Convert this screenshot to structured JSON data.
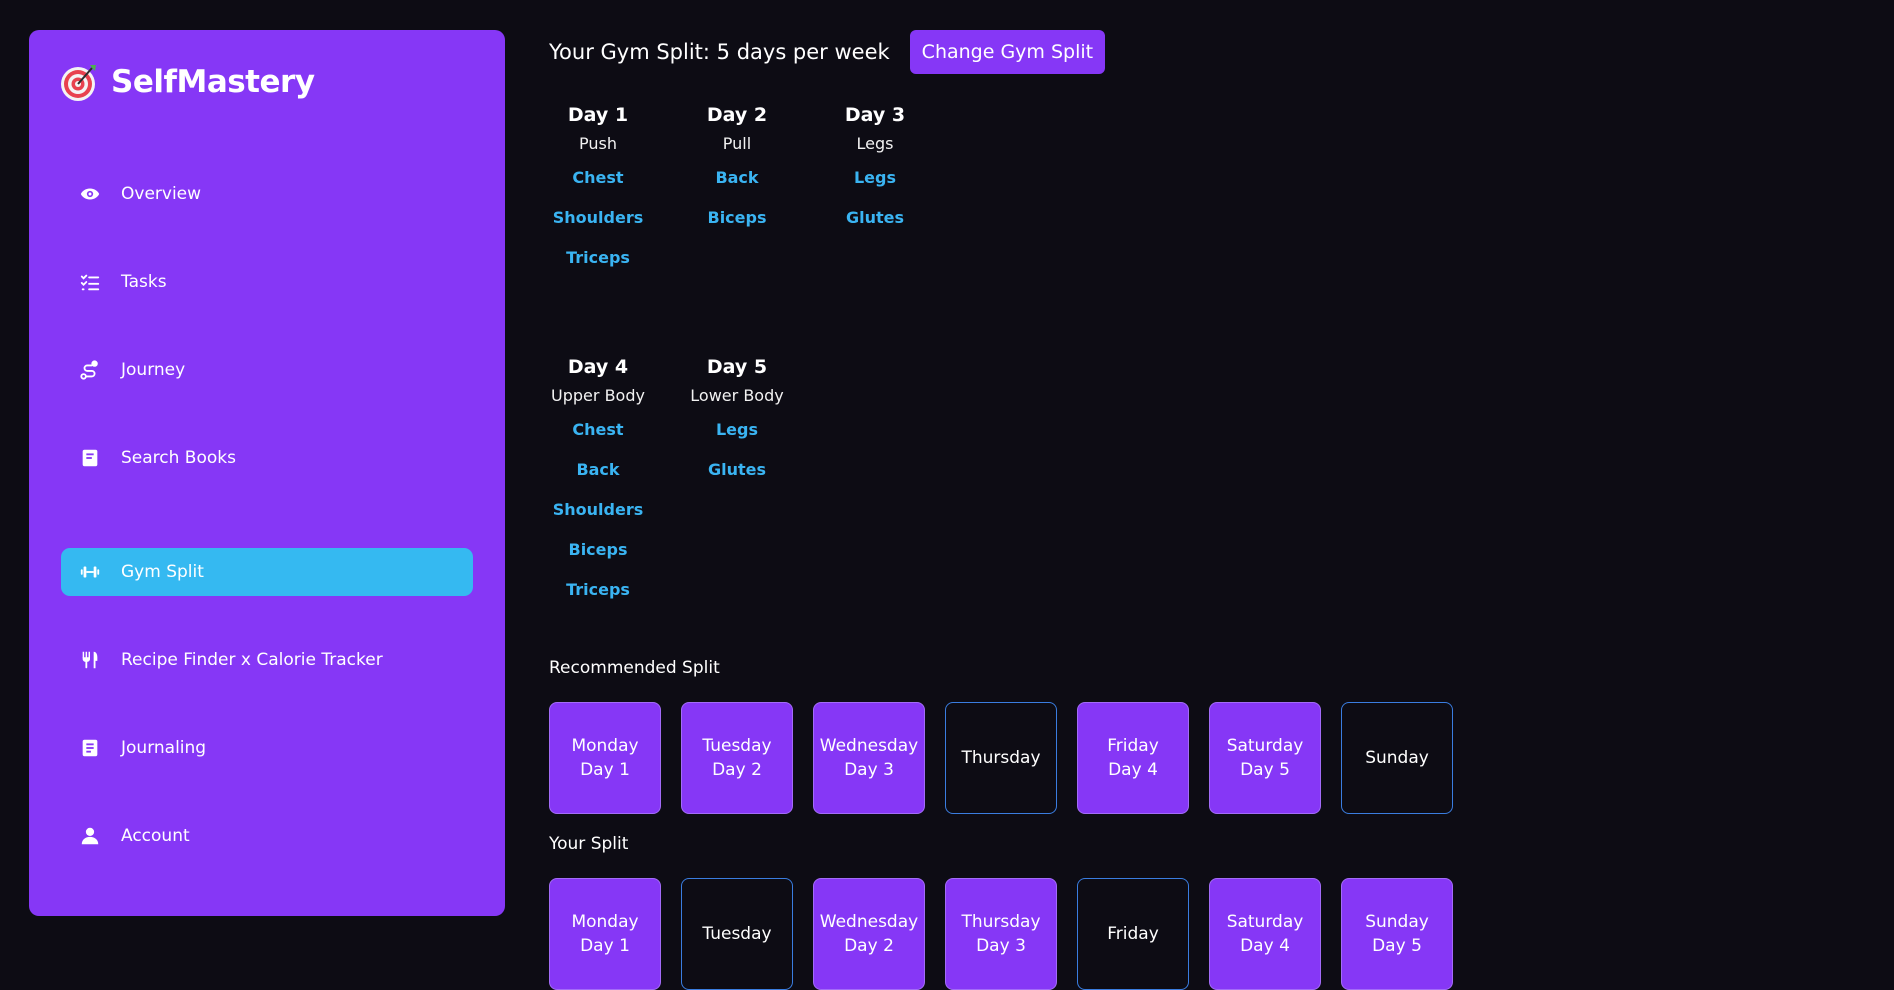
{
  "app": {
    "name": "SelfMastery",
    "logo_icon": "target-icon"
  },
  "sidebar": {
    "items": [
      {
        "label": "Overview",
        "icon": "eye-icon",
        "active": false
      },
      {
        "label": "Tasks",
        "icon": "checklist-icon",
        "active": false
      },
      {
        "label": "Journey",
        "icon": "route-icon",
        "active": false
      },
      {
        "label": "Search Books",
        "icon": "book-icon",
        "active": false
      },
      {
        "label": "Gym Split",
        "icon": "dumbbell-icon",
        "active": true
      },
      {
        "label": "Recipe Finder x Calorie Tracker",
        "icon": "utensils-icon",
        "active": false
      },
      {
        "label": "Journaling",
        "icon": "journal-icon",
        "active": false
      },
      {
        "label": "Account",
        "icon": "user-icon",
        "active": false
      }
    ]
  },
  "header": {
    "title": "Your Gym Split: 5 days per week",
    "change_button": "Change Gym Split"
  },
  "days": [
    {
      "title": "Day 1",
      "type": "Push",
      "muscles": [
        "Chest",
        "Shoulders",
        "Triceps"
      ]
    },
    {
      "title": "Day 2",
      "type": "Pull",
      "muscles": [
        "Back",
        "Biceps"
      ]
    },
    {
      "title": "Day 3",
      "type": "Legs",
      "muscles": [
        "Legs",
        "Glutes"
      ]
    },
    {
      "title": "Day 4",
      "type": "Upper Body",
      "muscles": [
        "Chest",
        "Back",
        "Shoulders",
        "Biceps",
        "Triceps"
      ]
    },
    {
      "title": "Day 5",
      "type": "Lower Body",
      "muscles": [
        "Legs",
        "Glutes"
      ]
    }
  ],
  "recommended": {
    "label": "Recommended Split",
    "week": [
      {
        "day": "Monday",
        "assigned": "Day 1"
      },
      {
        "day": "Tuesday",
        "assigned": "Day 2"
      },
      {
        "day": "Wednesday",
        "assigned": "Day 3"
      },
      {
        "day": "Thursday",
        "assigned": ""
      },
      {
        "day": "Friday",
        "assigned": "Day 4"
      },
      {
        "day": "Saturday",
        "assigned": "Day 5"
      },
      {
        "day": "Sunday",
        "assigned": ""
      }
    ]
  },
  "yours": {
    "label": "Your Split",
    "week": [
      {
        "day": "Monday",
        "assigned": "Day 1"
      },
      {
        "day": "Tuesday",
        "assigned": ""
      },
      {
        "day": "Wednesday",
        "assigned": "Day 2"
      },
      {
        "day": "Thursday",
        "assigned": "Day 3"
      },
      {
        "day": "Friday",
        "assigned": ""
      },
      {
        "day": "Saturday",
        "assigned": "Day 4"
      },
      {
        "day": "Sunday",
        "assigned": "Day 5"
      }
    ]
  },
  "colors": {
    "background": "#0d0c14",
    "accent_purple": "#8637f6",
    "active_blue": "#35b9f1",
    "muscle_link": "#3ab4f2",
    "rest_border": "#3a7de0"
  }
}
